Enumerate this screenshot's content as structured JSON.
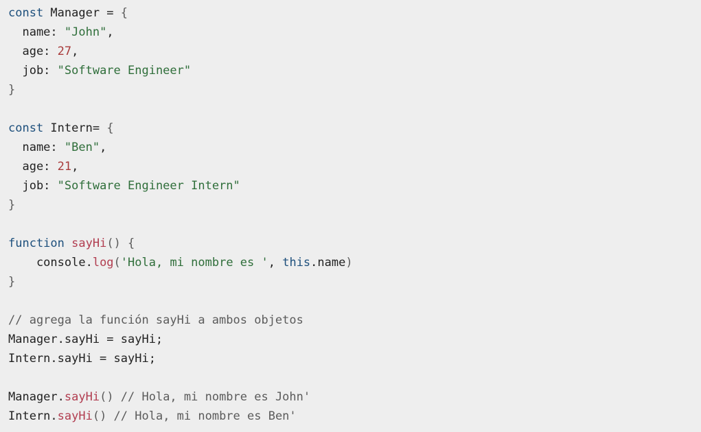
{
  "code": {
    "lines": [
      [
        {
          "t": "const",
          "c": "keyword"
        },
        {
          "t": " Manager = ",
          "c": "plain"
        },
        {
          "t": "{",
          "c": "punct"
        }
      ],
      [
        {
          "t": "  name: ",
          "c": "plain"
        },
        {
          "t": "\"John\"",
          "c": "string"
        },
        {
          "t": ",",
          "c": "plain"
        }
      ],
      [
        {
          "t": "  age: ",
          "c": "plain"
        },
        {
          "t": "27",
          "c": "number"
        },
        {
          "t": ",",
          "c": "plain"
        }
      ],
      [
        {
          "t": "  job: ",
          "c": "plain"
        },
        {
          "t": "\"Software Engineer\"",
          "c": "string"
        }
      ],
      [
        {
          "t": "}",
          "c": "punct"
        }
      ],
      [],
      [
        {
          "t": "const",
          "c": "keyword"
        },
        {
          "t": " Intern= ",
          "c": "plain"
        },
        {
          "t": "{",
          "c": "punct"
        }
      ],
      [
        {
          "t": "  name: ",
          "c": "plain"
        },
        {
          "t": "\"Ben\"",
          "c": "string"
        },
        {
          "t": ",",
          "c": "plain"
        }
      ],
      [
        {
          "t": "  age: ",
          "c": "plain"
        },
        {
          "t": "21",
          "c": "number"
        },
        {
          "t": ",",
          "c": "plain"
        }
      ],
      [
        {
          "t": "  job: ",
          "c": "plain"
        },
        {
          "t": "\"Software Engineer Intern\"",
          "c": "string"
        }
      ],
      [
        {
          "t": "}",
          "c": "punct"
        }
      ],
      [],
      [
        {
          "t": "function",
          "c": "keyword"
        },
        {
          "t": " ",
          "c": "plain"
        },
        {
          "t": "sayHi",
          "c": "func"
        },
        {
          "t": "() {",
          "c": "punct"
        }
      ],
      [
        {
          "t": "    console.",
          "c": "plain"
        },
        {
          "t": "log",
          "c": "func"
        },
        {
          "t": "(",
          "c": "punct"
        },
        {
          "t": "'Hola, mi nombre es '",
          "c": "string"
        },
        {
          "t": ", ",
          "c": "plain"
        },
        {
          "t": "this",
          "c": "keyword"
        },
        {
          "t": ".name",
          "c": "plain"
        },
        {
          "t": ")",
          "c": "punct"
        }
      ],
      [
        {
          "t": "}",
          "c": "punct"
        }
      ],
      [],
      [
        {
          "t": "// agrega la función sayHi a ambos objetos",
          "c": "comment"
        }
      ],
      [
        {
          "t": "Manager.sayHi = sayHi;",
          "c": "plain"
        }
      ],
      [
        {
          "t": "Intern.sayHi = sayHi;",
          "c": "plain"
        }
      ],
      [],
      [
        {
          "t": "Manager.",
          "c": "plain"
        },
        {
          "t": "sayHi",
          "c": "func"
        },
        {
          "t": "() // Hola, mi nombre es John'",
          "c": "comment"
        }
      ],
      [
        {
          "t": "Intern.",
          "c": "plain"
        },
        {
          "t": "sayHi",
          "c": "func"
        },
        {
          "t": "() // Hola, mi nombre es Ben'",
          "c": "comment"
        }
      ]
    ]
  },
  "colors": {
    "background": "#eeeeee",
    "keyword": "#1d4f7c",
    "string": "#2f6e3a",
    "number": "#a83a3a",
    "function": "#b13d50",
    "comment": "#5b5b5b",
    "plain": "#222222"
  }
}
